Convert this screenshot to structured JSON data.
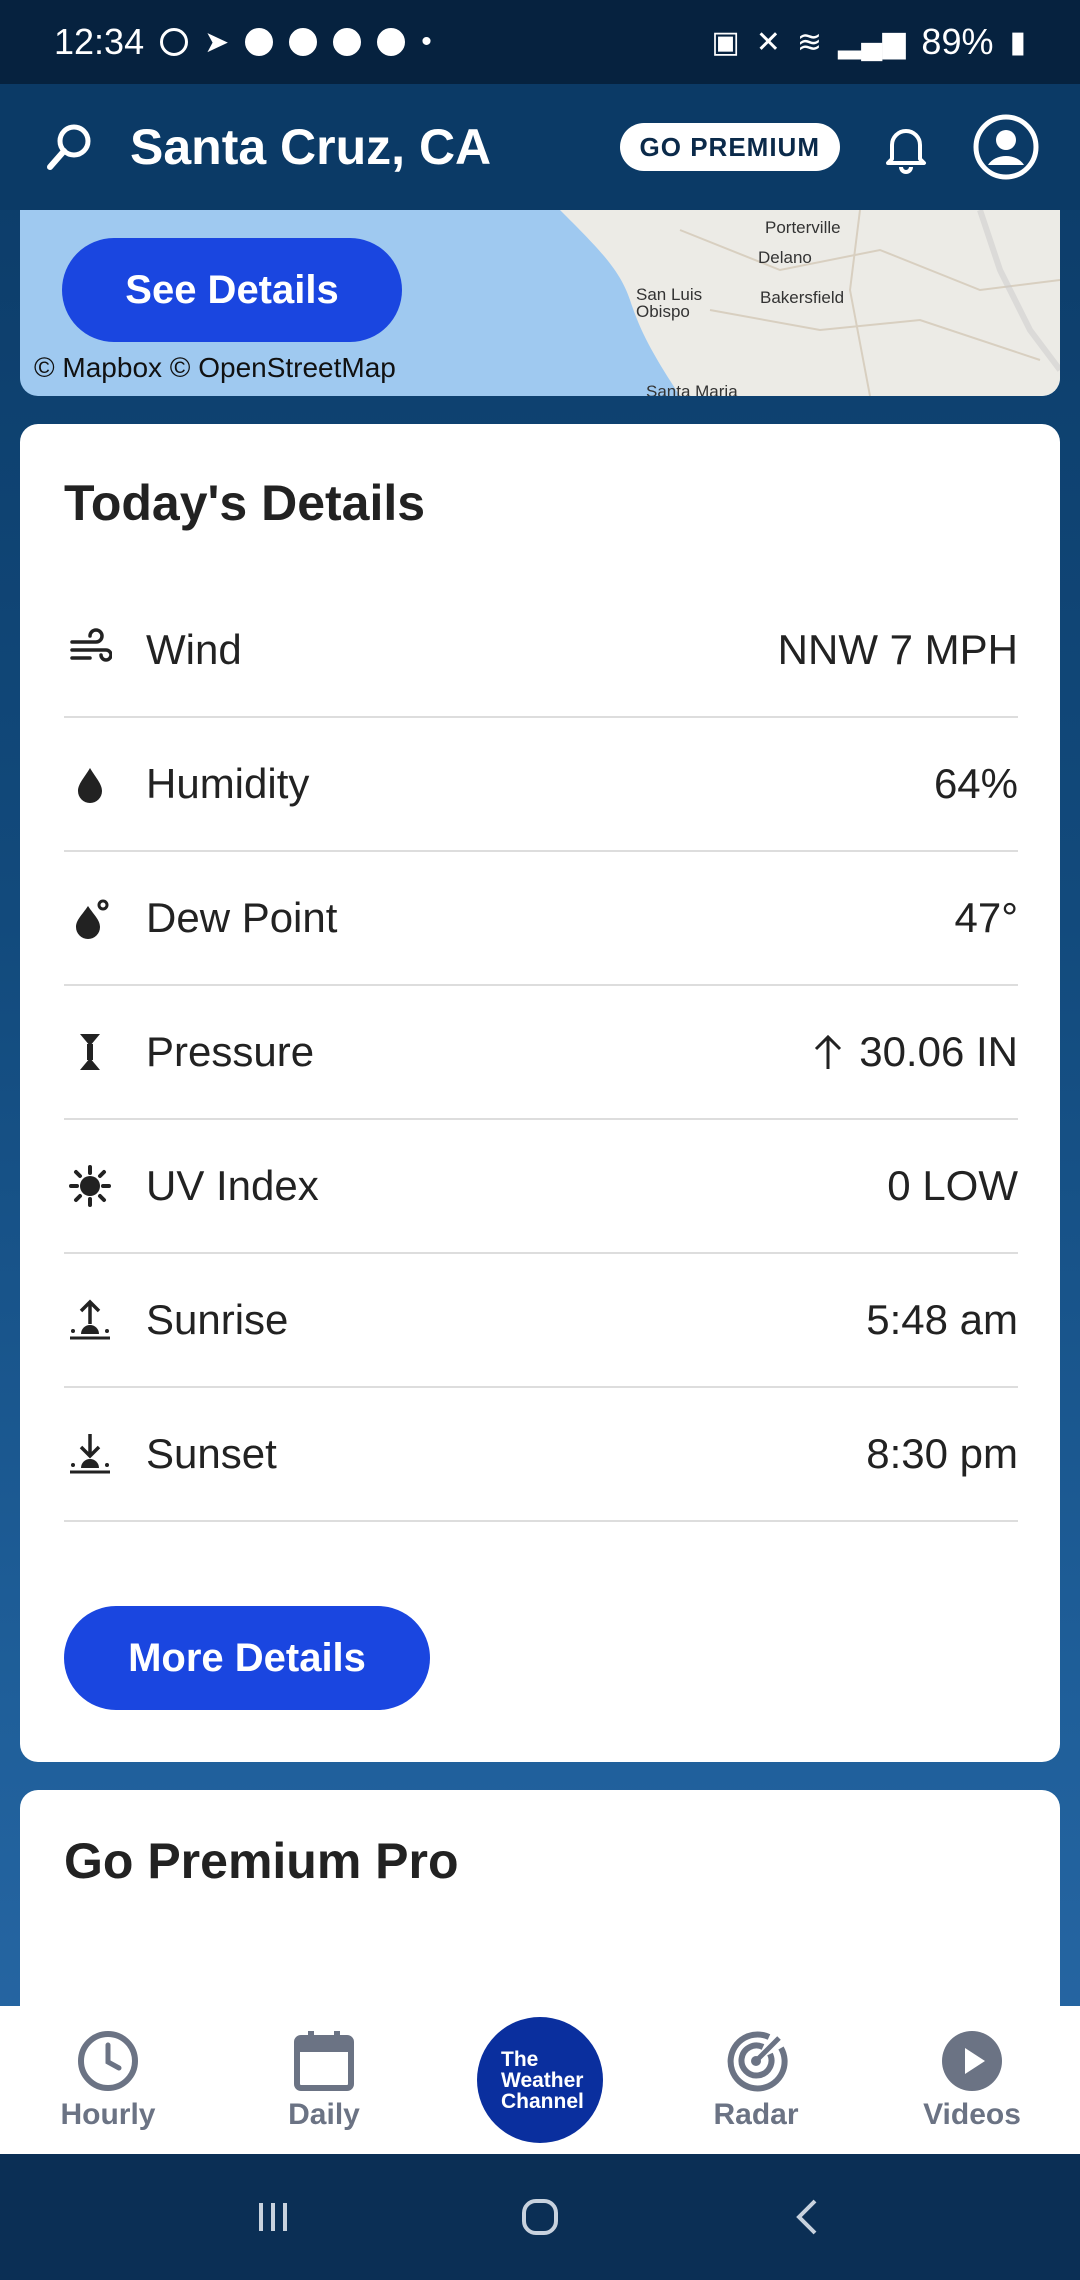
{
  "status_bar": {
    "time": "12:34",
    "battery": "89%",
    "icons": [
      "whatsapp-icon",
      "telegram-icon",
      "message-icon",
      "go-icon",
      "messenger-icon",
      "chat-icon",
      "dot-icon",
      "battery-saver-icon",
      "mute-icon",
      "wifi-icon",
      "signal-icon",
      "battery-icon"
    ]
  },
  "header": {
    "city": "Santa Cruz, CA",
    "premium_button": "GO PREMIUM"
  },
  "map": {
    "button": "See Details",
    "credit": "© Mapbox  © OpenStreetMap",
    "places": [
      "Porterville",
      "Delano",
      "San Luis Obispo",
      "Bakersfield",
      "Santa Maria"
    ]
  },
  "details": {
    "title": "Today's Details",
    "rows": [
      {
        "label": "Wind",
        "value": "NNW 7 MPH",
        "icon": "wind-icon"
      },
      {
        "label": "Humidity",
        "value": "64%",
        "icon": "humidity-icon"
      },
      {
        "label": "Dew Point",
        "value": "47°",
        "icon": "dew-point-icon"
      },
      {
        "label": "Pressure",
        "value": "30.06 IN",
        "icon": "pressure-icon",
        "trend": "rising"
      },
      {
        "label": "UV Index",
        "value": "0 LOW",
        "icon": "uv-index-icon"
      },
      {
        "label": "Sunrise",
        "value": "5:48 am",
        "icon": "sunrise-icon"
      },
      {
        "label": "Sunset",
        "value": "8:30 pm",
        "icon": "sunset-icon"
      }
    ],
    "more_button": "More Details"
  },
  "premium_card": {
    "title": "Go Premium Pro"
  },
  "bottom_nav": {
    "items": [
      {
        "label": "Hourly",
        "icon": "clock-icon"
      },
      {
        "label": "Daily",
        "icon": "calendar-icon"
      },
      {
        "label": "",
        "logo_lines": [
          "The",
          "Weather",
          "Channel"
        ]
      },
      {
        "label": "Radar",
        "icon": "radar-icon"
      },
      {
        "label": "Videos",
        "icon": "play-icon"
      }
    ]
  },
  "colors": {
    "accent": "#1a46e0",
    "header_bg": "#0b3a66",
    "nav_text": "#6b7384"
  }
}
